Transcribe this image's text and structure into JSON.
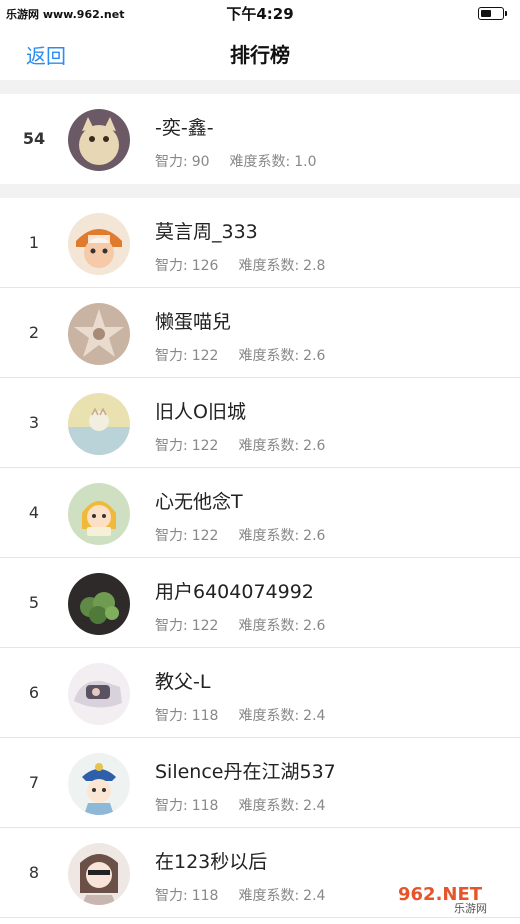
{
  "status_bar": {
    "watermark": "乐游网 www.962.net",
    "time": "下午4:29",
    "battery_level": 0.55
  },
  "nav": {
    "back_label": "返回",
    "title": "排行榜"
  },
  "labels": {
    "iq": "智力:",
    "difficulty": "难度系数:"
  },
  "my_rank": {
    "rank": "54",
    "name": "-奕-鑫-",
    "iq": "90",
    "difficulty": "1.0"
  },
  "rankings": [
    {
      "rank": "1",
      "name": "莫言周_333",
      "iq": "126",
      "difficulty": "2.8"
    },
    {
      "rank": "2",
      "name": "懒蛋喵兒",
      "iq": "122",
      "difficulty": "2.6"
    },
    {
      "rank": "3",
      "name": "旧人O旧城",
      "iq": "122",
      "difficulty": "2.6"
    },
    {
      "rank": "4",
      "name": "心无他念T",
      "iq": "122",
      "difficulty": "2.6"
    },
    {
      "rank": "5",
      "name": "用户6404074992",
      "iq": "122",
      "difficulty": "2.6"
    },
    {
      "rank": "6",
      "name": "教父-L",
      "iq": "118",
      "difficulty": "2.4"
    },
    {
      "rank": "7",
      "name": "Silence丹在江湖537",
      "iq": "118",
      "difficulty": "2.4"
    },
    {
      "rank": "8",
      "name": "在123秒以后",
      "iq": "118",
      "difficulty": "2.4"
    }
  ],
  "corner_logo": {
    "brand": "962.NET",
    "subtitle": "乐游网"
  },
  "colors": {
    "accent": "#2d8cf0",
    "separator": "#f2f2f2"
  }
}
